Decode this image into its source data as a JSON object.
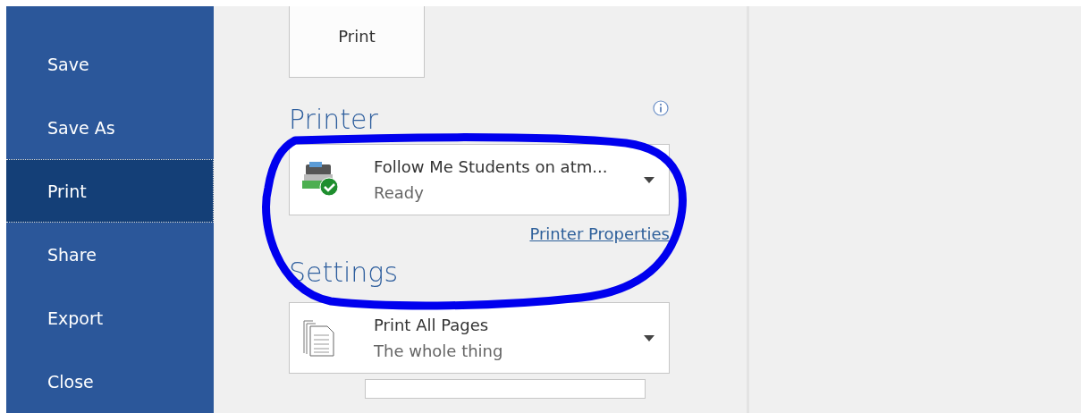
{
  "sidebar": {
    "items": [
      {
        "label": "Save",
        "selected": false
      },
      {
        "label": "Save As",
        "selected": false
      },
      {
        "label": "Print",
        "selected": true
      },
      {
        "label": "Share",
        "selected": false
      },
      {
        "label": "Export",
        "selected": false
      },
      {
        "label": "Close",
        "selected": false
      }
    ]
  },
  "print_button": {
    "label": "Print"
  },
  "printer": {
    "heading": "Printer",
    "name": "Follow Me Students on atm...",
    "status": "Ready",
    "ready": true,
    "properties_link": "Printer Properties"
  },
  "settings": {
    "heading": "Settings",
    "items": [
      {
        "title": "Print All Pages",
        "subtitle": "The whole thing"
      }
    ]
  }
}
